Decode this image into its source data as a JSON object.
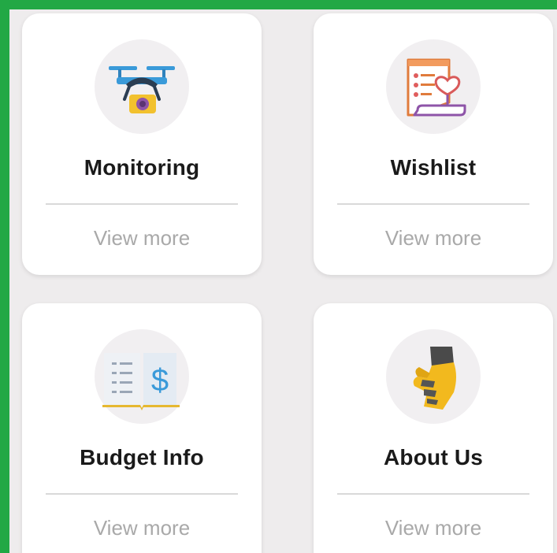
{
  "colors": {
    "frame_border": "#22a845",
    "background": "#eeeced",
    "card": "#ffffff",
    "icon_circle": "#f1eff1",
    "title": "#1a1a1a",
    "link": "#a9a9a9"
  },
  "cards": [
    {
      "title": "Monitoring",
      "icon": "drone-camera-icon",
      "link": "View more"
    },
    {
      "title": "Wishlist",
      "icon": "wishlist-heart-icon",
      "link": "View more"
    },
    {
      "title": "Budget Info",
      "icon": "budget-book-icon",
      "link": "View more"
    },
    {
      "title": "About Us",
      "icon": "hand-icon",
      "link": "View more"
    }
  ]
}
